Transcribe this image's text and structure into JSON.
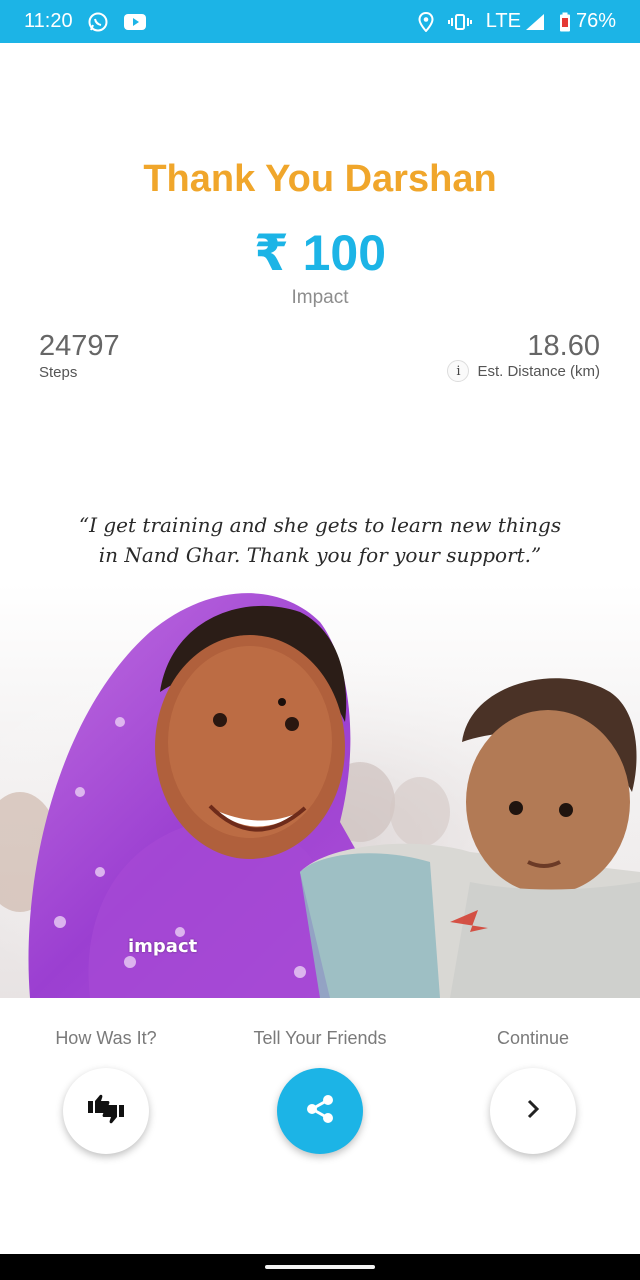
{
  "status_bar": {
    "time": "11:20",
    "network": "LTE",
    "battery": "76%",
    "icons": [
      "whatsapp-icon",
      "youtube-icon",
      "location-icon",
      "vibrate-icon",
      "signal-icon",
      "battery-icon"
    ],
    "bg_color": "#1cb4e6"
  },
  "header": {
    "title": "Thank You Darshan",
    "amount": "₹ 100",
    "amount_label": "Impact",
    "title_color": "#f0a62b",
    "amount_color": "#1cb4e6"
  },
  "stats": {
    "steps_value": "24797",
    "steps_label": "Steps",
    "distance_value": "18.60",
    "distance_label": "Est. Distance (km)",
    "info_icon_glyph": "i"
  },
  "image_card": {
    "quote_line_1": "“I get training and she gets to learn new things",
    "quote_line_2": "in Nand Ghar. Thank you for your support.”",
    "watermark": "impact"
  },
  "actions": {
    "feedback_label": "How Was It?",
    "share_label": "Tell Your Friends",
    "continue_label": "Continue",
    "feedback_icon": "thumbs-up-down-icon",
    "share_icon": "share-icon",
    "continue_icon": "chevron-right-icon"
  }
}
